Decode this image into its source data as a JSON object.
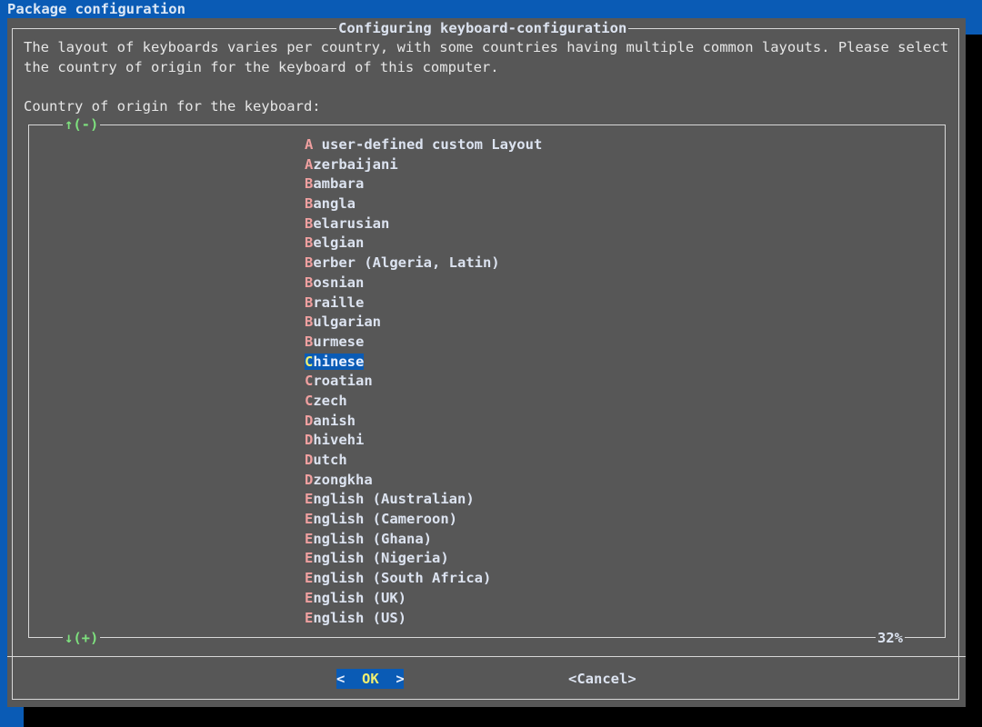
{
  "backtitle": "Package configuration",
  "dialog": {
    "title": "Configuring keyboard-configuration",
    "message_line1": "The layout of keyboards varies per country, with some countries having multiple common layouts. Please select",
    "message_line2": "the country of origin for the keyboard of this computer.",
    "prompt": "Country of origin for the keyboard:"
  },
  "list": {
    "scroll_up": "↑(-)",
    "scroll_down": "↓(+)",
    "scroll_percent": "32%",
    "selected": "Chinese",
    "items": [
      {
        "hot": "A",
        "rest": " user-defined custom Layout"
      },
      {
        "hot": "A",
        "rest": "zerbaijani"
      },
      {
        "hot": "B",
        "rest": "ambara"
      },
      {
        "hot": "B",
        "rest": "angla"
      },
      {
        "hot": "B",
        "rest": "elarusian"
      },
      {
        "hot": "B",
        "rest": "elgian"
      },
      {
        "hot": "B",
        "rest": "erber (Algeria, Latin)"
      },
      {
        "hot": "B",
        "rest": "osnian"
      },
      {
        "hot": "B",
        "rest": "raille"
      },
      {
        "hot": "B",
        "rest": "ulgarian"
      },
      {
        "hot": "B",
        "rest": "urmese"
      },
      {
        "hot": "C",
        "rest": "hinese"
      },
      {
        "hot": "C",
        "rest": "roatian"
      },
      {
        "hot": "C",
        "rest": "zech"
      },
      {
        "hot": "D",
        "rest": "anish"
      },
      {
        "hot": "D",
        "rest": "hivehi"
      },
      {
        "hot": "D",
        "rest": "utch"
      },
      {
        "hot": "D",
        "rest": "zongkha"
      },
      {
        "hot": "E",
        "rest": "nglish (Australian)"
      },
      {
        "hot": "E",
        "rest": "nglish (Cameroon)"
      },
      {
        "hot": "E",
        "rest": "nglish (Ghana)"
      },
      {
        "hot": "E",
        "rest": "nglish (Nigeria)"
      },
      {
        "hot": "E",
        "rest": "nglish (South Africa)"
      },
      {
        "hot": "E",
        "rest": "nglish (UK)"
      },
      {
        "hot": "E",
        "rest": "nglish (US)"
      }
    ]
  },
  "buttons": {
    "ok_left": "<",
    "ok_label": "OK",
    "ok_right": ">",
    "cancel_label": "<Cancel>"
  },
  "colors": {
    "desktop_background": "#0a5bb5",
    "dialog_background": "#575757",
    "selection_background": "#0a5bb5",
    "hotkey": "#f0a0a0",
    "scroll_indicator": "#7ee07e"
  }
}
